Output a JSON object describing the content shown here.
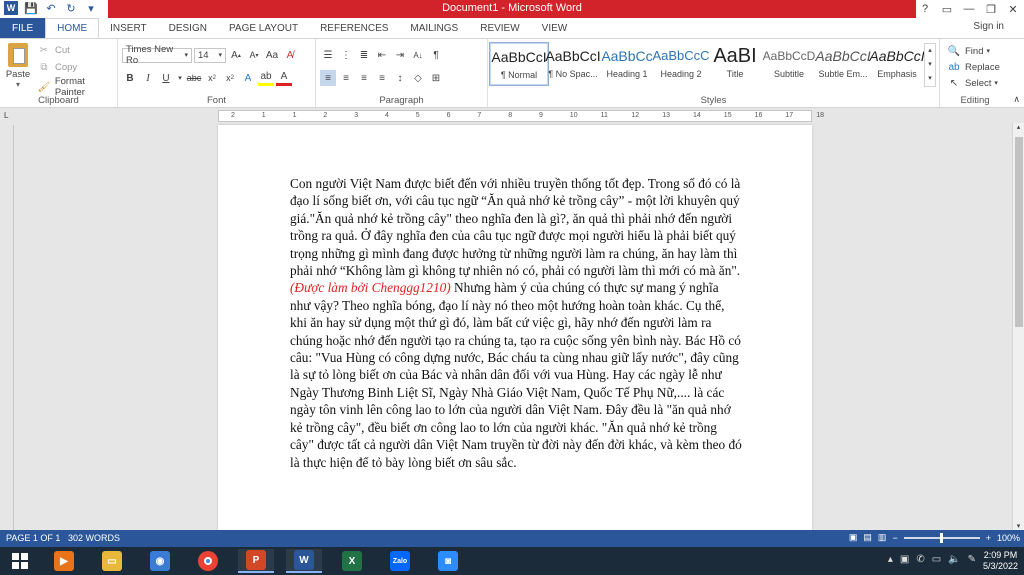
{
  "window": {
    "title": "Document1 - Microsoft Word",
    "controls": [
      "?",
      "▭",
      "—",
      "❐",
      "✕"
    ]
  },
  "tabs": [
    "FILE",
    "HOME",
    "INSERT",
    "DESIGN",
    "PAGE LAYOUT",
    "REFERENCES",
    "MAILINGS",
    "REVIEW",
    "VIEW"
  ],
  "sign_in": "Sign in",
  "clipboard": {
    "paste": "Paste",
    "cut": "Cut",
    "copy": "Copy",
    "format_painter": "Format Painter",
    "label": "Clipboard"
  },
  "font": {
    "name": "Times New Ro",
    "size": "14",
    "label": "Font"
  },
  "paragraph": {
    "label": "Paragraph"
  },
  "styles": {
    "label": "Styles",
    "items": [
      {
        "sample": "AaBbCcI",
        "name": "¶ Normal"
      },
      {
        "sample": "AaBbCcI",
        "name": "¶ No Spac..."
      },
      {
        "sample": "AaBbCc",
        "name": "Heading 1"
      },
      {
        "sample": "AaBbCcC",
        "name": "Heading 2"
      },
      {
        "sample": "AaBI",
        "name": "Title"
      },
      {
        "sample": "AaBbCcD",
        "name": "Subtitle"
      },
      {
        "sample": "AaBbCcI",
        "name": "Subtle Em..."
      },
      {
        "sample": "AaBbCcI",
        "name": "Emphasis"
      }
    ]
  },
  "editing": {
    "find": "Find",
    "replace": "Replace",
    "select": "Select",
    "label": "Editing"
  },
  "ruler": {
    "marks": [
      "2",
      "1",
      "1",
      "2",
      "3",
      "4",
      "5",
      "6",
      "7",
      "8",
      "9",
      "10",
      "11",
      "12",
      "13",
      "14",
      "15",
      "16",
      "17",
      "18"
    ]
  },
  "document": {
    "text_before": "Con người Việt Nam được biết đến với nhiều truyền thống tốt đẹp. Trong số đó có là đạo lí sống biết ơn, với câu tục ngữ “Ăn quả nhớ kẻ trồng cây” - một lời khuyên quý giá.\"Ăn quả nhớ kẻ trồng cây\" theo nghĩa đen là gì?, ăn quả thì phải nhớ đến người trồng ra quả. Ở đây nghĩa đen của câu tục ngữ được mọi người hiểu là phải biết quý trọng những gì mình đang được hưởng từ những người làm ra chúng, ăn hay làm thì phải nhớ “Không làm gì không tự nhiên nó có, phải có người làm thì mới có mà ăn\". ",
    "text_red": "(Được làm bởi Chenggg1210)",
    "text_after": " Nhưng hàm ý của chúng có thực sự mang ý nghĩa như vậy? Theo nghĩa bóng, đạo lí này nó theo một hướng hoàn toàn khác. Cụ thể, khi ăn hay sử dụng một thứ gì đó, làm bất cứ việc gì, hãy nhớ đến người làm ra chúng hoặc nhớ đến người tạo ra chúng ta, tạo ra cuộc sống yên bình này. Bác Hồ có câu: \"Vua Hùng có công dựng nước, Bác cháu ta cùng nhau giữ lấy nước\", đây cũng là sự tỏ lòng biết ơn của Bác và nhân dân đối với vua Hùng. Hay các ngày lễ như Ngày Thương Binh Liệt Sĩ, Ngày Nhà Giáo Việt Nam, Quốc Tế Phụ Nữ,.... là các ngày tôn vinh lên công lao to lớn của người dân Việt Nam. Đây đều là \"ăn quả nhớ kẻ trồng cây\", đều biết ơn công lao to lớn của người khác. \"Ăn quả nhớ kẻ trồng cây\" được tất cả người dân Việt Nam truyền từ đời này đến đời khác, và kèm theo đó là thực hiện để tỏ bày lòng biết ơn sâu sắc."
  },
  "status": {
    "page": "PAGE 1 OF 1",
    "words": "302 WORDS",
    "zoom": "100%"
  },
  "taskbar": {
    "apps": [
      "media-player",
      "file-explorer",
      "camera-app",
      "chrome",
      "powerpoint",
      "word",
      "excel",
      "zalo",
      "zoom"
    ],
    "zalo_label": "Zalo",
    "time": "2:09 PM",
    "date": "5/3/2022"
  },
  "colors": {
    "accent": "#2b579a",
    "title_red": "#d2232a",
    "doc_red": "#e02020"
  }
}
